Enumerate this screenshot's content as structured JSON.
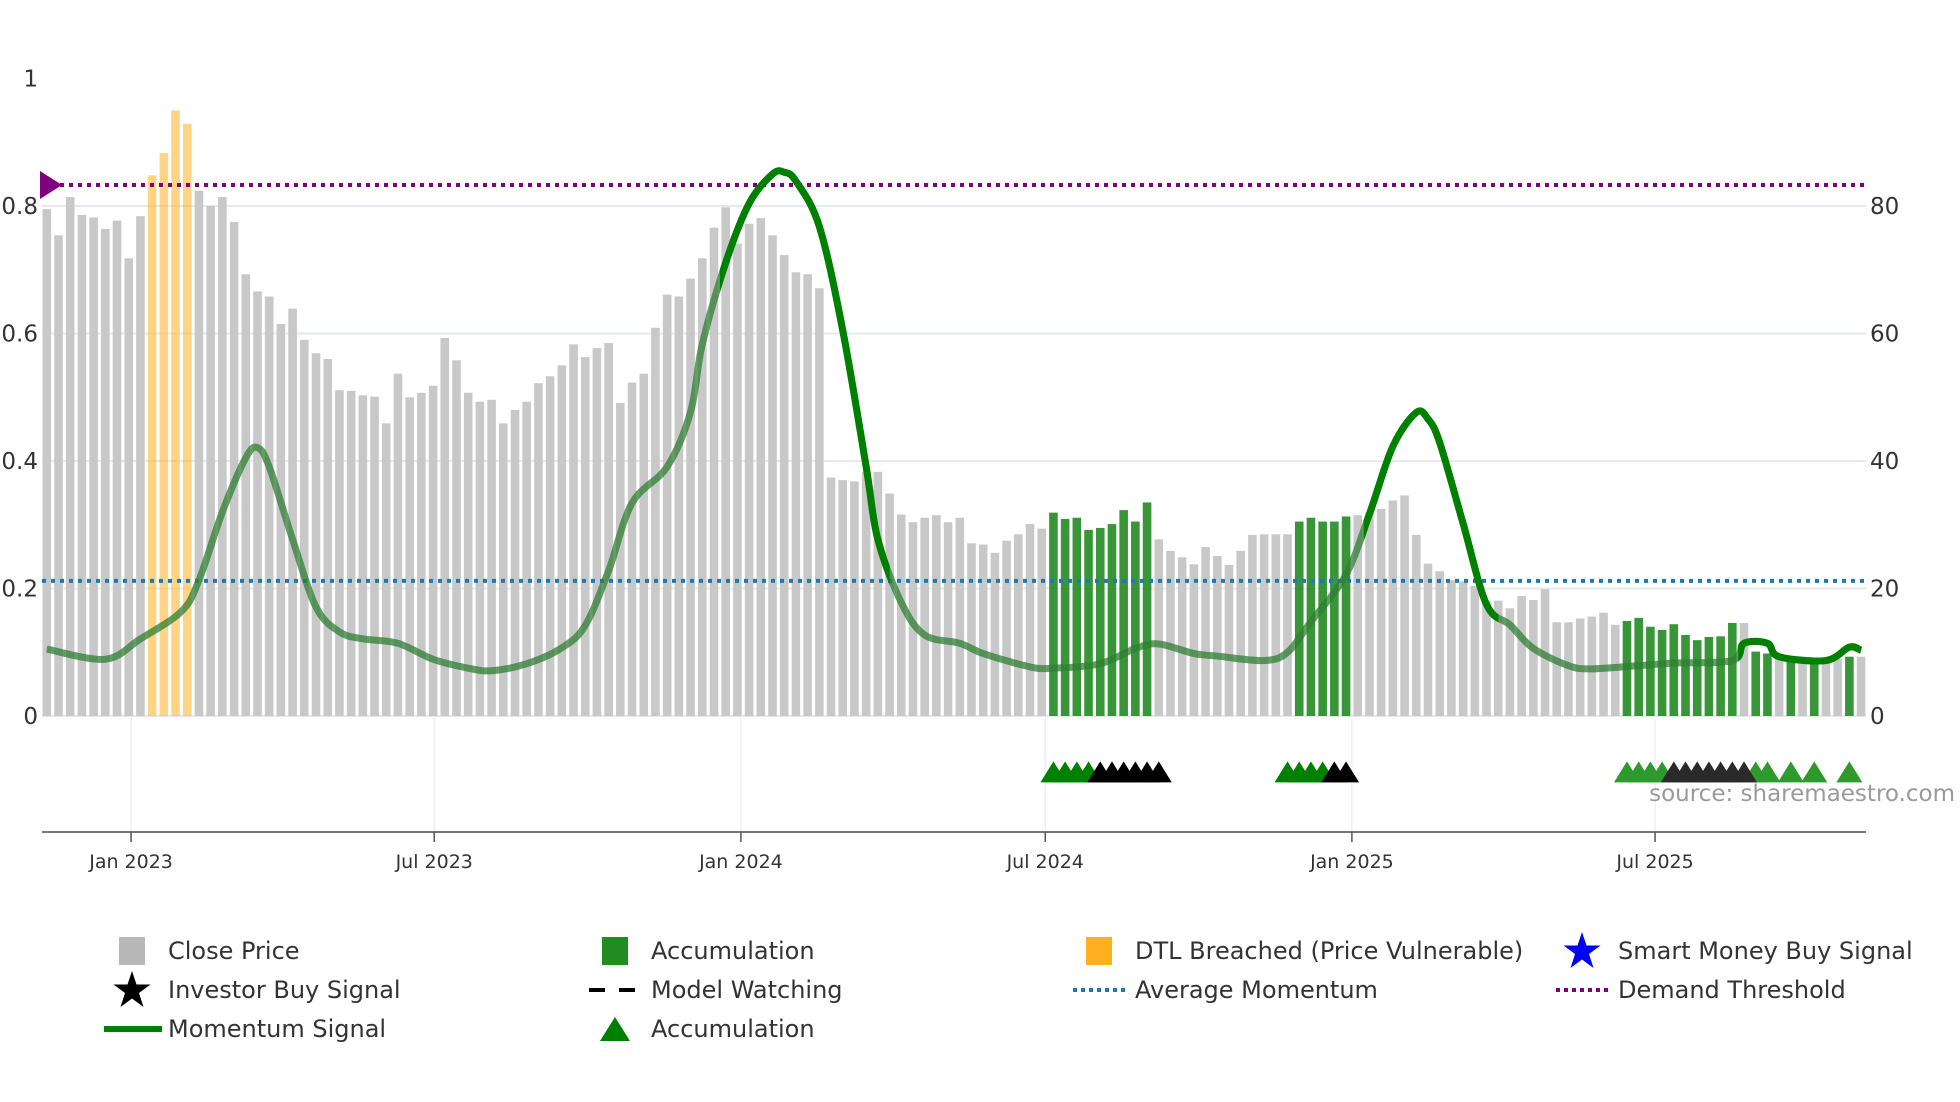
{
  "chart_data": {
    "type": "bar",
    "title": "",
    "xlabel": "",
    "ylabel": "",
    "ylim": [
      0,
      100
    ],
    "left_axis_ticks": [
      "0",
      "0.2",
      "0.4",
      "0.6",
      "0.8",
      "1"
    ],
    "left_axis_values": [
      0,
      0.2,
      0.4,
      0.6,
      0.8,
      1
    ],
    "right_axis_ticks": [
      "0",
      "20",
      "40",
      "60",
      "80"
    ],
    "right_axis_values": [
      0,
      20,
      40,
      60,
      80
    ],
    "x_ticks": [
      {
        "label": "Jan 2023",
        "week": 8.2
      },
      {
        "label": "Jul 2023",
        "week": 34.1
      },
      {
        "label": "Jan 2024",
        "week": 60.3
      },
      {
        "label": "Jul 2024",
        "week": 86.3
      },
      {
        "label": "Jan 2025",
        "week": 112.5
      },
      {
        "label": "Jul 2025",
        "week": 138.4
      }
    ],
    "close_price": [
      79.5,
      75.4,
      81.4,
      78.6,
      78.2,
      76.4,
      77.7,
      71.8,
      78.4,
      84.8,
      88.3,
      95,
      92.9,
      82.4,
      80,
      81.4,
      77.5,
      69.3,
      66.6,
      65.8,
      61.5,
      63.9,
      59,
      56.9,
      56,
      51.1,
      51,
      50.3,
      50.1,
      45.9,
      53.7,
      50,
      50.7,
      51.8,
      59.3,
      55.8,
      50.7,
      49.3,
      49.6,
      45.9,
      48,
      49.3,
      52.2,
      53.3,
      55,
      58.3,
      56.3,
      57.7,
      58.5,
      49.1,
      52.3,
      53.7,
      60.9,
      66.1,
      65.8,
      68.6,
      71.8,
      76.6,
      79.8,
      74.1,
      77.2,
      78.1,
      75.4,
      72.3,
      69.6,
      69.3,
      67.1,
      37.4,
      37,
      36.8,
      38.3,
      38.3,
      34.9,
      31.6,
      30.4,
      31.1,
      31.5,
      30.4,
      31.1,
      27.1,
      26.9,
      25.6,
      27.5,
      28.5,
      30.1,
      29.4,
      31.9,
      30.9,
      31.1,
      29.2,
      29.5,
      30.1,
      32.3,
      30.5,
      33.5,
      27.7,
      25.9,
      24.9,
      23.8,
      26.5,
      25.1,
      23.7,
      25.9,
      28.4,
      28.5,
      28.5,
      28.5,
      30.5,
      31.1,
      30.5,
      30.5,
      31.3,
      31.5,
      31.9,
      32.5,
      33.8,
      34.6,
      28.4,
      23.9,
      22.7,
      21.3,
      21.1,
      20.4,
      18,
      18.1,
      16.9,
      18.8,
      18.2,
      19.9,
      14.7,
      14.7,
      15.3,
      15.6,
      16.2,
      14.3,
      14.9,
      15.4,
      14,
      13.5,
      14.4,
      12.7,
      11.9,
      12.4,
      12.5,
      14.6,
      14.6,
      10.1,
      9.8,
      9.1,
      8.7,
      9.3,
      8.3,
      8.7,
      9,
      9.3,
      9.3
    ],
    "dtl_breached_weeks": [
      10,
      11,
      12,
      13
    ],
    "accumulation_weeks": [
      87,
      88,
      89,
      90,
      91,
      92,
      93,
      94,
      95,
      108,
      109,
      110,
      111,
      112,
      136,
      137,
      138,
      139,
      140,
      141,
      142,
      143,
      144,
      145,
      147,
      148,
      150,
      152,
      155
    ],
    "momentum_signal": [
      [
        1,
        10.5
      ],
      [
        6,
        8.9
      ],
      [
        9,
        12.1
      ],
      [
        12.5,
        16.4
      ],
      [
        14,
        21.3
      ],
      [
        16,
        32
      ],
      [
        18,
        40.5
      ],
      [
        19,
        42.1
      ],
      [
        20,
        39.1
      ],
      [
        22,
        27.7
      ],
      [
        24,
        17.1
      ],
      [
        26,
        13.2
      ],
      [
        28,
        12.1
      ],
      [
        31,
        11.4
      ],
      [
        34,
        8.9
      ],
      [
        37,
        7.5
      ],
      [
        39,
        7.1
      ],
      [
        42,
        8.2
      ],
      [
        45,
        10.7
      ],
      [
        47,
        14.2
      ],
      [
        49,
        22.8
      ],
      [
        51,
        33.4
      ],
      [
        54,
        39.1
      ],
      [
        56,
        47.7
      ],
      [
        57,
        58.3
      ],
      [
        59,
        71.1
      ],
      [
        61,
        80.4
      ],
      [
        63,
        85
      ],
      [
        64,
        85.3
      ],
      [
        65,
        83.9
      ],
      [
        67,
        76.8
      ],
      [
        69,
        60.5
      ],
      [
        71,
        39.1
      ],
      [
        72,
        27.7
      ],
      [
        74,
        17.8
      ],
      [
        76,
        12.7
      ],
      [
        79,
        11.4
      ],
      [
        81,
        9.8
      ],
      [
        85,
        7.7
      ],
      [
        87,
        7.5
      ],
      [
        91,
        8.2
      ],
      [
        94,
        10.6
      ],
      [
        96,
        11.3
      ],
      [
        99,
        9.8
      ],
      [
        101,
        9.4
      ],
      [
        105,
        8.7
      ],
      [
        107,
        10
      ],
      [
        109,
        14.8
      ],
      [
        112,
        22.2
      ],
      [
        114,
        31.7
      ],
      [
        116,
        42.3
      ],
      [
        118,
        47.6
      ],
      [
        119,
        46.6
      ],
      [
        120,
        42.9
      ],
      [
        122,
        30.2
      ],
      [
        124,
        17.5
      ],
      [
        126,
        14.3
      ],
      [
        128,
        10.6
      ],
      [
        131,
        7.9
      ],
      [
        133,
        7.4
      ],
      [
        137,
        7.9
      ],
      [
        140,
        8.3
      ],
      [
        145,
        8.7
      ],
      [
        146,
        11.4
      ],
      [
        148,
        11.4
      ],
      [
        149,
        9.3
      ],
      [
        153,
        8.7
      ],
      [
        155,
        10.8
      ],
      [
        156,
        10.3
      ]
    ],
    "momentum_strong_ranges": [
      [
        58.5,
        72.5
      ],
      [
        113.5,
        124.5
      ],
      [
        145.5,
        156
      ]
    ],
    "average_momentum": 21.2,
    "demand_threshold": 83.3,
    "accumulation_triangle_weeks": [
      87,
      88,
      89,
      90,
      107,
      108,
      109,
      110,
      136,
      137,
      138,
      139,
      147,
      148,
      150,
      152,
      155
    ],
    "investor_buy_weeks": [
      91,
      92,
      93,
      94,
      95,
      96,
      111,
      112,
      140,
      141,
      142,
      143,
      144,
      145,
      146
    ],
    "source": "source: sharemaestro.com",
    "colors": {
      "close_price": "#c8c8c8",
      "accumulation": "#228b22",
      "dtl": "#ffb020",
      "momentum": "#008000",
      "average_momentum": "#1f77b4",
      "demand_threshold": "#800080",
      "smart_money": "#0000ff",
      "investor": "#000000"
    }
  },
  "legend": {
    "close_price": "Close Price",
    "accumulation_bar": "Accumulation",
    "dtl": "DTL Breached (Price Vulnerable)",
    "smart_money": "Smart Money Buy Signal",
    "investor": "Investor Buy Signal",
    "model_watching": "Model Watching",
    "average_momentum": "Average Momentum",
    "demand_threshold": "Demand Threshold",
    "momentum": "Momentum Signal",
    "accumulation_triangle": "Accumulation"
  }
}
